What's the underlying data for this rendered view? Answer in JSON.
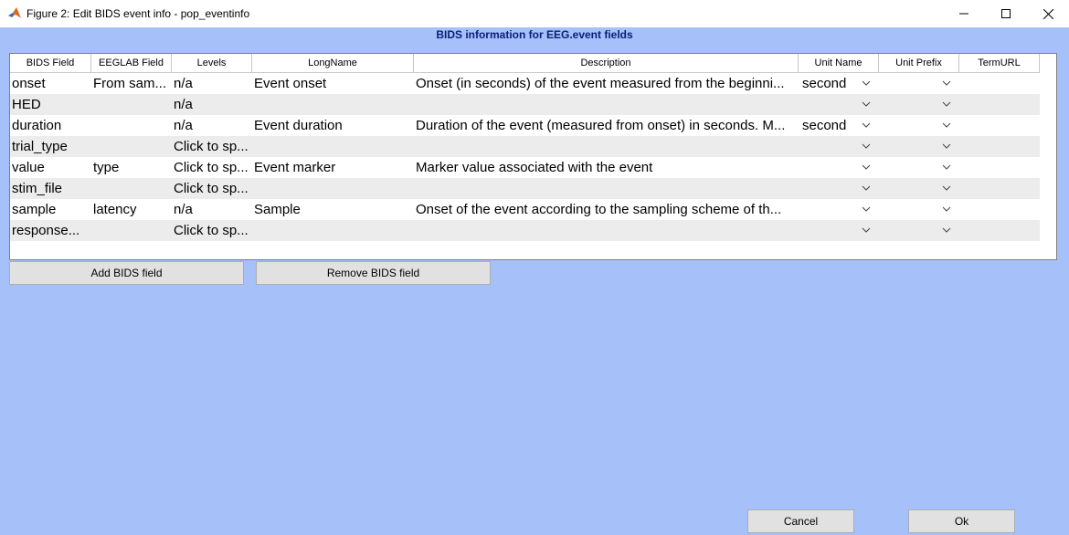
{
  "window": {
    "title": "Figure 2: Edit BIDS event info - pop_eventinfo",
    "icon": "matlab-icon"
  },
  "panel": {
    "title": "BIDS information for EEG.event fields"
  },
  "table": {
    "columns": [
      "BIDS Field",
      "EEGLAB Field",
      "Levels",
      "LongName",
      "Description",
      "Unit Name",
      "Unit Prefix",
      "TermURL"
    ],
    "rows": [
      {
        "bids_field": "onset",
        "eeglab_field": "From sam...",
        "levels": "n/a",
        "longname": "Event onset",
        "description": "Onset (in seconds) of the event measured from the beginni...",
        "unit_name": "second",
        "unit_prefix": "",
        "term_url": ""
      },
      {
        "bids_field": "HED",
        "eeglab_field": "",
        "levels": "n/a",
        "longname": "",
        "description": "",
        "unit_name": "",
        "unit_prefix": "",
        "term_url": ""
      },
      {
        "bids_field": "duration",
        "eeglab_field": "",
        "levels": "n/a",
        "longname": "Event duration",
        "description": "Duration of the event (measured from onset) in seconds. M...",
        "unit_name": "second",
        "unit_prefix": "",
        "term_url": ""
      },
      {
        "bids_field": "trial_type",
        "eeglab_field": "",
        "levels": "Click to sp...",
        "longname": "",
        "description": "",
        "unit_name": "",
        "unit_prefix": "",
        "term_url": ""
      },
      {
        "bids_field": "value",
        "eeglab_field": "type",
        "levels": "Click to sp...",
        "longname": "Event marker",
        "description": "Marker value associated with the event",
        "unit_name": "",
        "unit_prefix": "",
        "term_url": ""
      },
      {
        "bids_field": "stim_file",
        "eeglab_field": "",
        "levels": "Click to sp...",
        "longname": "",
        "description": "",
        "unit_name": "",
        "unit_prefix": "",
        "term_url": ""
      },
      {
        "bids_field": "sample",
        "eeglab_field": "latency",
        "levels": "n/a",
        "longname": "Sample",
        "description": "Onset of the event according to the sampling scheme of th...",
        "unit_name": "",
        "unit_prefix": "",
        "term_url": ""
      },
      {
        "bids_field": "response...",
        "eeglab_field": "",
        "levels": "Click to sp...",
        "longname": "",
        "description": "",
        "unit_name": "",
        "unit_prefix": "",
        "term_url": ""
      }
    ]
  },
  "buttons": {
    "add": "Add BIDS field",
    "remove": "Remove BIDS field",
    "cancel": "Cancel",
    "ok": "Ok"
  },
  "colors": {
    "background": "#a6c0fa",
    "panel_title": "#0a1e78",
    "row_alt": "#ececec",
    "button_face": "#e1e1e1"
  }
}
